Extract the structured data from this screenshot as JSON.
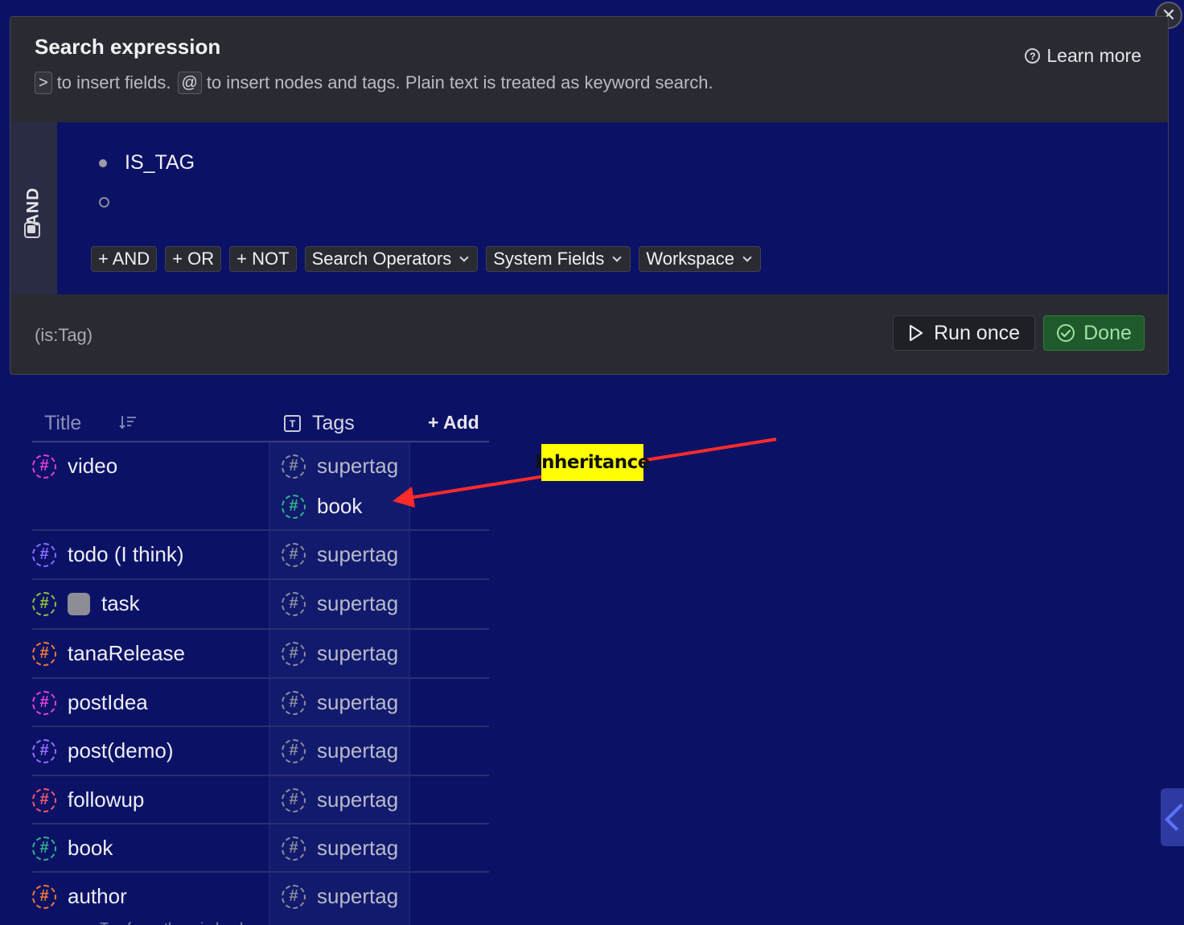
{
  "search_panel": {
    "title": "Search expression",
    "hint_key_fields": ">",
    "hint_fields_text": "to insert fields.",
    "hint_key_nodes": "@",
    "hint_nodes_text": "to insert nodes and tags. Plain text is treated as keyword search.",
    "learn_more_label": "Learn more",
    "group_operator": "AND",
    "expression_items": [
      "IS_TAG",
      ""
    ],
    "chips": {
      "and": "+ AND",
      "or": "+ OR",
      "not": "+ NOT",
      "search_operators": "Search Operators",
      "system_fields": "System Fields",
      "workspace": "Workspace"
    },
    "query_text": "(is:Tag)",
    "run_once_label": "Run once",
    "done_label": "Done"
  },
  "table": {
    "title_header": "Title",
    "tags_header": "Tags",
    "add_label": "+ Add",
    "rows": [
      {
        "title": "video",
        "color": "#e040d8",
        "tags": [
          {
            "label": "supertag",
            "color": "#8a8c9a"
          },
          {
            "label": "book",
            "color": "#2fb38a"
          }
        ]
      },
      {
        "title": "todo (I think)",
        "color": "#8a6cff",
        "tags": [
          {
            "label": "supertag",
            "color": "#8a8c9a"
          }
        ]
      },
      {
        "title": "task",
        "color": "#8fbf3a",
        "checkbox": true,
        "tags": [
          {
            "label": "supertag",
            "color": "#8a8c9a"
          }
        ]
      },
      {
        "title": "tanaRelease",
        "color": "#f07a32",
        "tags": [
          {
            "label": "supertag",
            "color": "#8a8c9a"
          }
        ]
      },
      {
        "title": "postIdea",
        "color": "#e040d8",
        "tags": [
          {
            "label": "supertag",
            "color": "#8a8c9a"
          }
        ]
      },
      {
        "title": "post(demo)",
        "color": "#9a6cff",
        "tags": [
          {
            "label": "supertag",
            "color": "#8a8c9a"
          }
        ]
      },
      {
        "title": "followup",
        "color": "#f05a6a",
        "tags": [
          {
            "label": "supertag",
            "color": "#8a8c9a"
          }
        ]
      },
      {
        "title": "book",
        "color": "#2fb38a",
        "tags": [
          {
            "label": "supertag",
            "color": "#8a8c9a"
          }
        ]
      },
      {
        "title": "author",
        "color": "#f07a32",
        "tags": [
          {
            "label": "supertag",
            "color": "#8a8c9a"
          }
        ]
      }
    ],
    "cut_off_description": "Tag for authors in books"
  },
  "annotation": {
    "label": "Inheritance",
    "color": "#ffff00",
    "arrow_color": "#ff2a2a"
  },
  "colors": {
    "background": "#0b1266",
    "panel": "#2a2b32",
    "done_green": "#1e5a2c"
  }
}
